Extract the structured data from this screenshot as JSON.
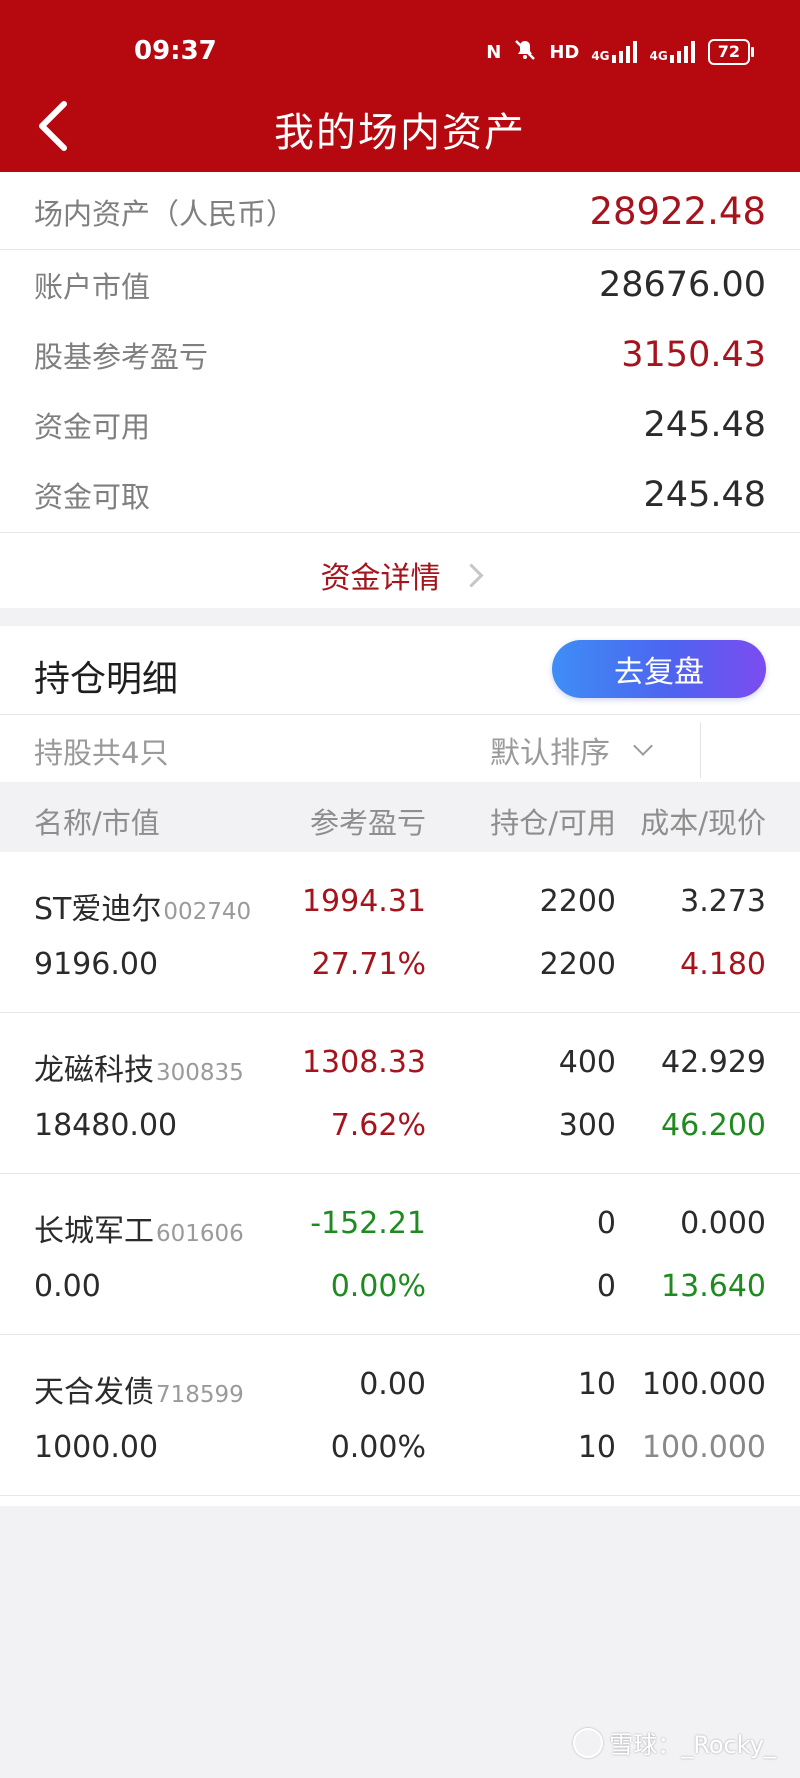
{
  "status_bar": {
    "time": "09:37",
    "icons": [
      "nfc-icon",
      "mute-icon",
      "hd-icon",
      "signal-4g-icon",
      "signal-4g-icon"
    ],
    "nfc": "N",
    "hd": "HD",
    "net1": "4G",
    "net2": "4G",
    "battery": "72"
  },
  "header": {
    "title": "我的场内资产"
  },
  "assets": {
    "total_label": "场内资产（人民币）",
    "total_value": "28922.48",
    "rows": [
      {
        "label": "账户市值",
        "value": "28676.00"
      },
      {
        "label": "股基参考盈亏",
        "value": "3150.43"
      },
      {
        "label": "资金可用",
        "value": "245.48"
      },
      {
        "label": "资金可取",
        "value": "245.48"
      }
    ],
    "detail_link": "资金详情"
  },
  "holdings": {
    "title": "持仓明细",
    "review_button": "去复盘",
    "count_text": "持股共4只",
    "sort_label": "默认排序",
    "columns": [
      "名称/市值",
      "参考盈亏",
      "持仓/可用",
      "成本/现价"
    ],
    "stocks": [
      {
        "name": "ST爱迪尔",
        "code": "002740",
        "market_value": "9196.00",
        "pnl": "1994.31",
        "pnl_pct": "27.71%",
        "position": "2200",
        "available": "2200",
        "cost": "3.273",
        "price": "4.180"
      },
      {
        "name": "龙磁科技",
        "code": "300835",
        "market_value": "18480.00",
        "pnl": "1308.33",
        "pnl_pct": "7.62%",
        "position": "400",
        "available": "300",
        "cost": "42.929",
        "price": "46.200"
      },
      {
        "name": "长城军工",
        "code": "601606",
        "market_value": "0.00",
        "pnl": "-152.21",
        "pnl_pct": "0.00%",
        "position": "0",
        "available": "0",
        "cost": "0.000",
        "price": "13.640"
      },
      {
        "name": "天合发债",
        "code": "718599",
        "market_value": "1000.00",
        "pnl": "0.00",
        "pnl_pct": "0.00%",
        "position": "10",
        "available": "10",
        "cost": "100.000",
        "price": "100.000"
      }
    ]
  },
  "watermark": "雪球：_Rocky_",
  "colors": {
    "header": "#b5080f",
    "gain": "#a5141c",
    "loss": "#1f8a1f",
    "button_start": "#3e8ef5",
    "button_end": "#7c4cf0"
  }
}
